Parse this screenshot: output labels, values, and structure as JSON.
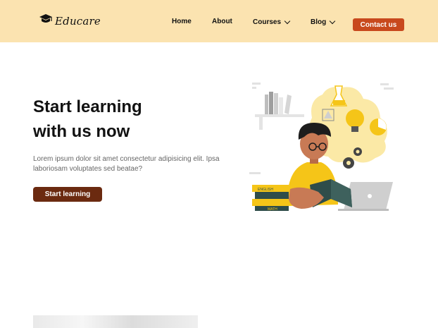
{
  "header": {
    "brand": "Educare",
    "nav": {
      "home": "Home",
      "about": "About",
      "courses": "Courses",
      "blog": "Blog"
    },
    "contact_label": "Contact us"
  },
  "hero": {
    "title_line1": "Start learning",
    "title_line2": "with us now",
    "description": "Lorem ipsum dolor sit amet consectetur adipisicing elit. Ipsa laboriosam  voluptates sed beatae?",
    "cta_label": "Start learning"
  },
  "illustration": {
    "book_labels": [
      "ENGLISH",
      "MATH"
    ]
  },
  "colors": {
    "header_bg": "#fbe3b0",
    "contact_button": "#c8491d",
    "cta_button": "#6b2a10",
    "accent_yellow": "#f5c518"
  },
  "icons": [
    "graduation-cap-icon",
    "chevron-down-icon"
  ]
}
